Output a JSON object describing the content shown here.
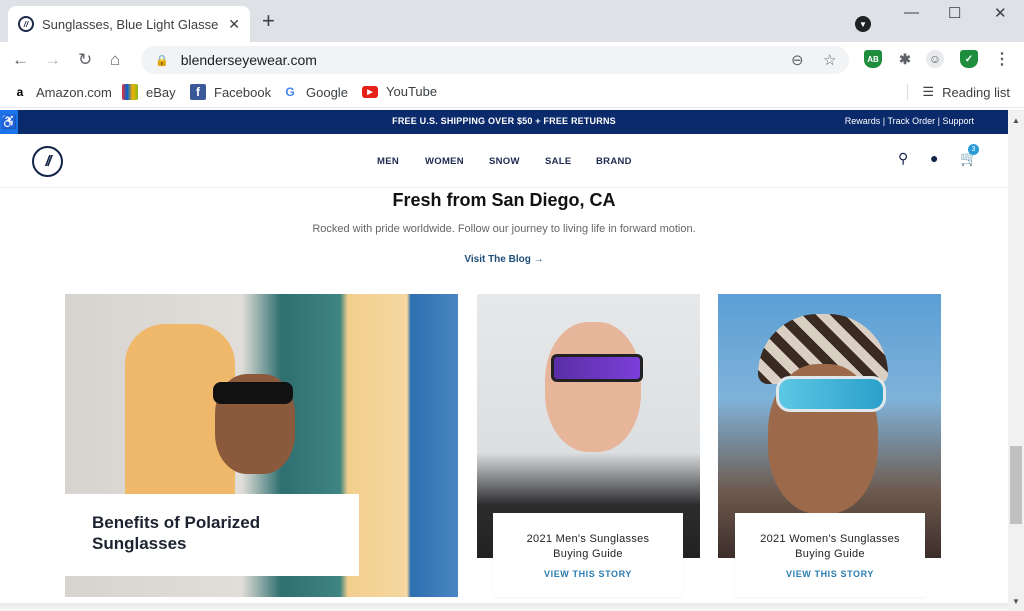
{
  "browser": {
    "tab_title": "Sunglasses, Blue Light Glasses & ",
    "url": "blenderseyewear.com",
    "extensions": [
      "AB",
      "puzzle",
      "profile",
      "shield-check"
    ],
    "bookmarks": [
      {
        "label": "Amazon.com",
        "icon": "amazon-icon"
      },
      {
        "label": "eBay",
        "icon": "ebay-icon"
      },
      {
        "label": "Facebook",
        "icon": "facebook-icon"
      },
      {
        "label": "Google",
        "icon": "google-icon"
      },
      {
        "label": "YouTube",
        "icon": "youtube-icon"
      }
    ],
    "reading_list": "Reading list"
  },
  "site": {
    "promo": "FREE U.S. SHIPPING OVER $50 + FREE RETURNS",
    "top_links": [
      "Rewards",
      "Track Order",
      "Support"
    ],
    "nav": [
      "MEN",
      "WOMEN",
      "SNOW",
      "SALE",
      "BRAND"
    ],
    "cart_count": "3",
    "colors": {
      "navy": "#0a2a6b",
      "accent": "#2b9bd8"
    }
  },
  "section": {
    "title": "Fresh from San Diego, CA",
    "subtitle": "Rocked with pride worldwide. Follow our journey to living life in forward motion.",
    "link": "Visit The Blog →"
  },
  "stories": [
    {
      "title_line1": "Benefits of Polarized",
      "title_line2": "Sunglasses"
    },
    {
      "title_line1": "2021 Men's Sunglasses",
      "title_line2": "Buying Guide",
      "cta": "VIEW THIS STORY"
    },
    {
      "title_line1": "2021 Women's Sunglasses",
      "title_line2": "Buying Guide",
      "cta": "VIEW THIS STORY"
    }
  ]
}
